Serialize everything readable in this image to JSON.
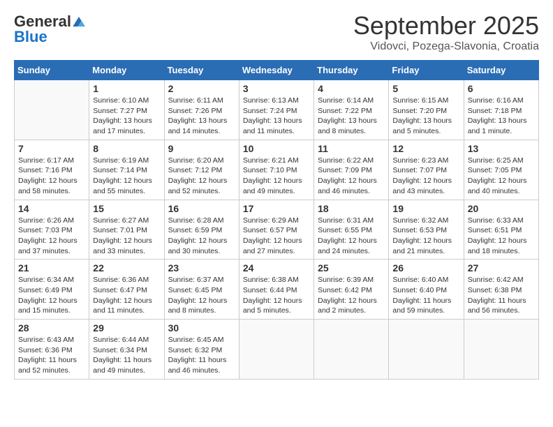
{
  "logo": {
    "general": "General",
    "blue": "Blue"
  },
  "title": "September 2025",
  "location": "Vidovci, Pozega-Slavonia, Croatia",
  "weekdays": [
    "Sunday",
    "Monday",
    "Tuesday",
    "Wednesday",
    "Thursday",
    "Friday",
    "Saturday"
  ],
  "weeks": [
    [
      {
        "day": "",
        "info": ""
      },
      {
        "day": "1",
        "info": "Sunrise: 6:10 AM\nSunset: 7:27 PM\nDaylight: 13 hours\nand 17 minutes."
      },
      {
        "day": "2",
        "info": "Sunrise: 6:11 AM\nSunset: 7:26 PM\nDaylight: 13 hours\nand 14 minutes."
      },
      {
        "day": "3",
        "info": "Sunrise: 6:13 AM\nSunset: 7:24 PM\nDaylight: 13 hours\nand 11 minutes."
      },
      {
        "day": "4",
        "info": "Sunrise: 6:14 AM\nSunset: 7:22 PM\nDaylight: 13 hours\nand 8 minutes."
      },
      {
        "day": "5",
        "info": "Sunrise: 6:15 AM\nSunset: 7:20 PM\nDaylight: 13 hours\nand 5 minutes."
      },
      {
        "day": "6",
        "info": "Sunrise: 6:16 AM\nSunset: 7:18 PM\nDaylight: 13 hours\nand 1 minute."
      }
    ],
    [
      {
        "day": "7",
        "info": "Sunrise: 6:17 AM\nSunset: 7:16 PM\nDaylight: 12 hours\nand 58 minutes."
      },
      {
        "day": "8",
        "info": "Sunrise: 6:19 AM\nSunset: 7:14 PM\nDaylight: 12 hours\nand 55 minutes."
      },
      {
        "day": "9",
        "info": "Sunrise: 6:20 AM\nSunset: 7:12 PM\nDaylight: 12 hours\nand 52 minutes."
      },
      {
        "day": "10",
        "info": "Sunrise: 6:21 AM\nSunset: 7:10 PM\nDaylight: 12 hours\nand 49 minutes."
      },
      {
        "day": "11",
        "info": "Sunrise: 6:22 AM\nSunset: 7:09 PM\nDaylight: 12 hours\nand 46 minutes."
      },
      {
        "day": "12",
        "info": "Sunrise: 6:23 AM\nSunset: 7:07 PM\nDaylight: 12 hours\nand 43 minutes."
      },
      {
        "day": "13",
        "info": "Sunrise: 6:25 AM\nSunset: 7:05 PM\nDaylight: 12 hours\nand 40 minutes."
      }
    ],
    [
      {
        "day": "14",
        "info": "Sunrise: 6:26 AM\nSunset: 7:03 PM\nDaylight: 12 hours\nand 37 minutes."
      },
      {
        "day": "15",
        "info": "Sunrise: 6:27 AM\nSunset: 7:01 PM\nDaylight: 12 hours\nand 33 minutes."
      },
      {
        "day": "16",
        "info": "Sunrise: 6:28 AM\nSunset: 6:59 PM\nDaylight: 12 hours\nand 30 minutes."
      },
      {
        "day": "17",
        "info": "Sunrise: 6:29 AM\nSunset: 6:57 PM\nDaylight: 12 hours\nand 27 minutes."
      },
      {
        "day": "18",
        "info": "Sunrise: 6:31 AM\nSunset: 6:55 PM\nDaylight: 12 hours\nand 24 minutes."
      },
      {
        "day": "19",
        "info": "Sunrise: 6:32 AM\nSunset: 6:53 PM\nDaylight: 12 hours\nand 21 minutes."
      },
      {
        "day": "20",
        "info": "Sunrise: 6:33 AM\nSunset: 6:51 PM\nDaylight: 12 hours\nand 18 minutes."
      }
    ],
    [
      {
        "day": "21",
        "info": "Sunrise: 6:34 AM\nSunset: 6:49 PM\nDaylight: 12 hours\nand 15 minutes."
      },
      {
        "day": "22",
        "info": "Sunrise: 6:36 AM\nSunset: 6:47 PM\nDaylight: 12 hours\nand 11 minutes."
      },
      {
        "day": "23",
        "info": "Sunrise: 6:37 AM\nSunset: 6:45 PM\nDaylight: 12 hours\nand 8 minutes."
      },
      {
        "day": "24",
        "info": "Sunrise: 6:38 AM\nSunset: 6:44 PM\nDaylight: 12 hours\nand 5 minutes."
      },
      {
        "day": "25",
        "info": "Sunrise: 6:39 AM\nSunset: 6:42 PM\nDaylight: 12 hours\nand 2 minutes."
      },
      {
        "day": "26",
        "info": "Sunrise: 6:40 AM\nSunset: 6:40 PM\nDaylight: 11 hours\nand 59 minutes."
      },
      {
        "day": "27",
        "info": "Sunrise: 6:42 AM\nSunset: 6:38 PM\nDaylight: 11 hours\nand 56 minutes."
      }
    ],
    [
      {
        "day": "28",
        "info": "Sunrise: 6:43 AM\nSunset: 6:36 PM\nDaylight: 11 hours\nand 52 minutes."
      },
      {
        "day": "29",
        "info": "Sunrise: 6:44 AM\nSunset: 6:34 PM\nDaylight: 11 hours\nand 49 minutes."
      },
      {
        "day": "30",
        "info": "Sunrise: 6:45 AM\nSunset: 6:32 PM\nDaylight: 11 hours\nand 46 minutes."
      },
      {
        "day": "",
        "info": ""
      },
      {
        "day": "",
        "info": ""
      },
      {
        "day": "",
        "info": ""
      },
      {
        "day": "",
        "info": ""
      }
    ]
  ]
}
